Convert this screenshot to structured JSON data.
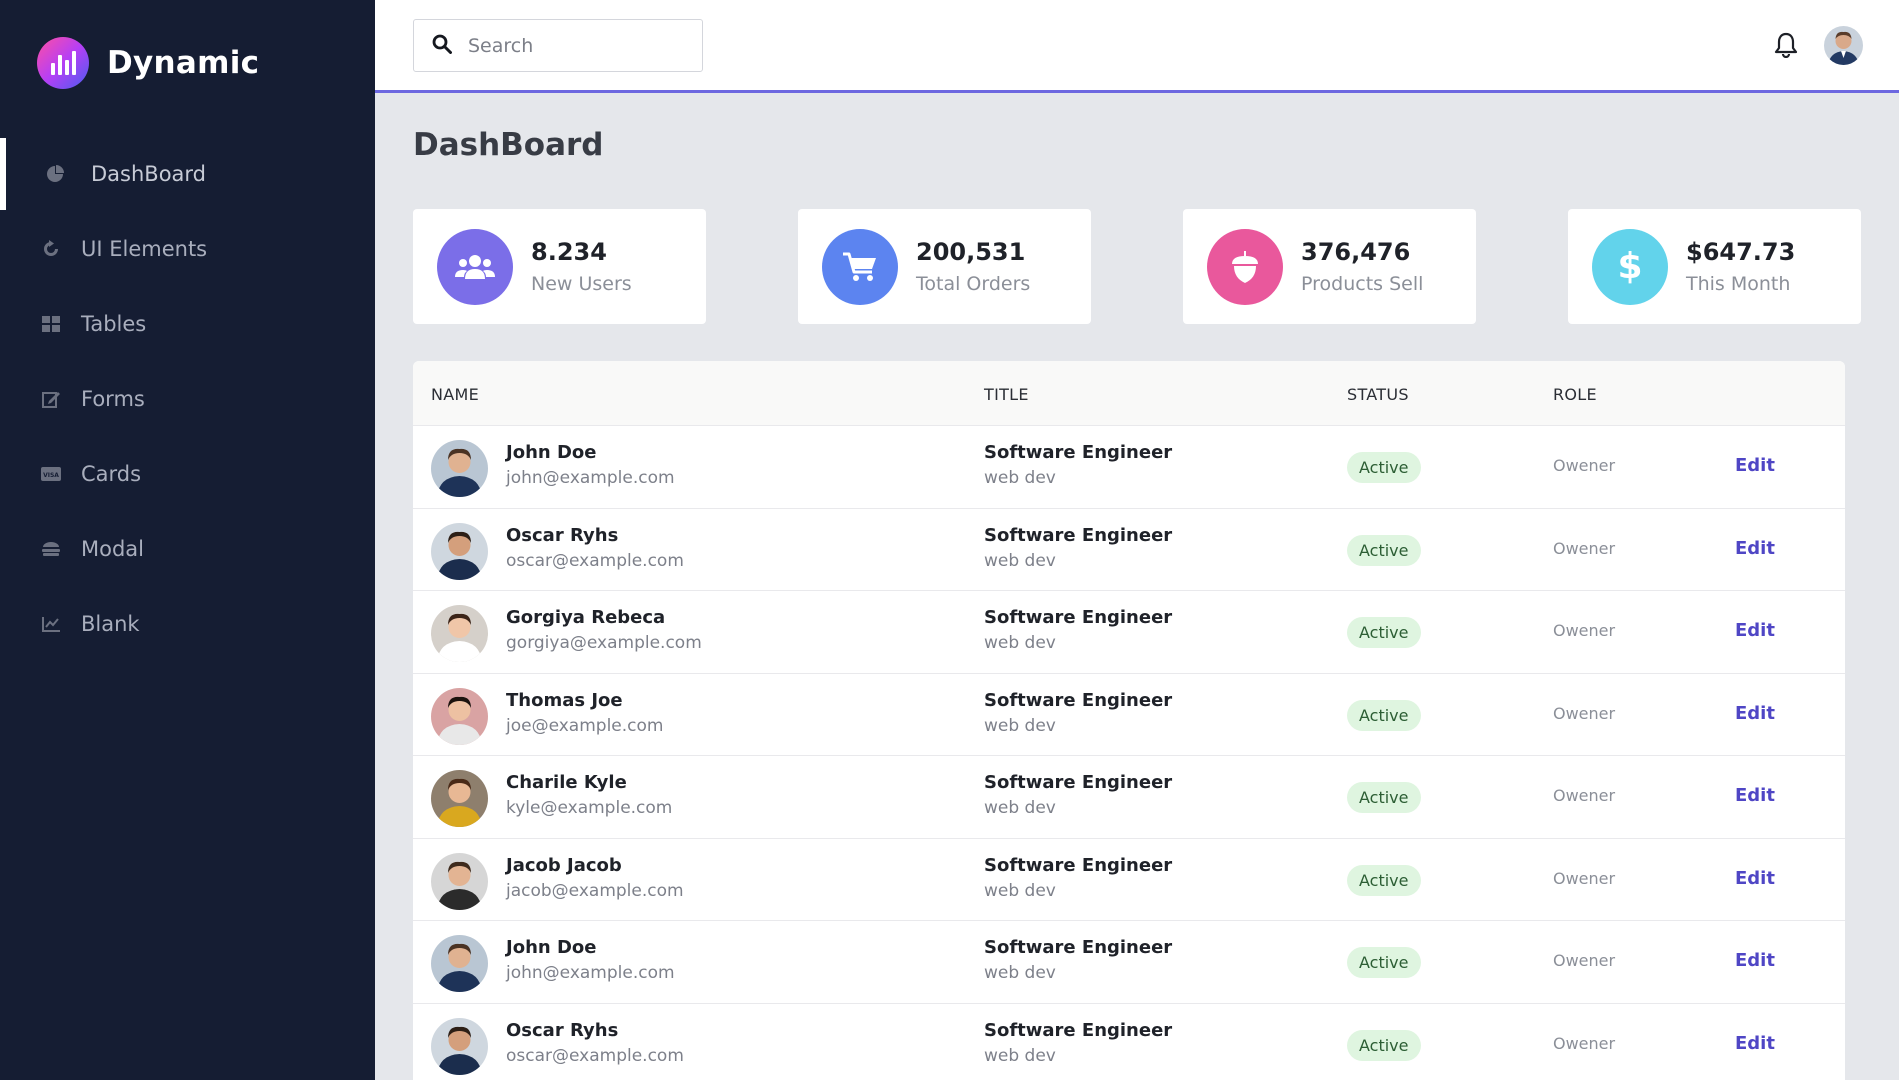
{
  "brand": {
    "name": "Dynamic"
  },
  "sidebar": {
    "items": [
      {
        "label": "DashBoard",
        "icon": "pie-chart-icon",
        "active": true
      },
      {
        "label": "UI Elements",
        "icon": "refresh-icon"
      },
      {
        "label": "Tables",
        "icon": "grid-icon"
      },
      {
        "label": "Forms",
        "icon": "edit-icon"
      },
      {
        "label": "Cards",
        "icon": "credit-card-icon"
      },
      {
        "label": "Modal",
        "icon": "layers-icon"
      },
      {
        "label": "Blank",
        "icon": "line-chart-icon"
      }
    ]
  },
  "header": {
    "search_placeholder": "Search"
  },
  "main": {
    "title": "DashBoard",
    "stats": [
      {
        "value": "8.234",
        "label": "New Users",
        "icon": "users-icon",
        "color": "#7b6ee8"
      },
      {
        "value": "200,531",
        "label": "Total Orders",
        "icon": "cart-icon",
        "color": "#5c84f0"
      },
      {
        "value": "376,476",
        "label": "Products Sell",
        "icon": "acorn-icon",
        "color": "#e9589c"
      },
      {
        "value": "$647.73",
        "label": "This Month",
        "icon": "dollar-icon",
        "color": "#62d3eb"
      }
    ],
    "table": {
      "headers": {
        "name": "NAME",
        "title": "TITLE",
        "status": "STATUS",
        "role": "ROLE"
      },
      "rows": [
        {
          "name": "John Doe",
          "email": "john@example.com",
          "title": "Software Engineer",
          "subtitle": "web dev",
          "status": "Active",
          "role": "Owener",
          "action": "Edit"
        },
        {
          "name": "Oscar Ryhs",
          "email": "oscar@example.com",
          "title": "Software Engineer",
          "subtitle": "web dev",
          "status": "Active",
          "role": "Owener",
          "action": "Edit"
        },
        {
          "name": "Gorgiya Rebeca",
          "email": "gorgiya@example.com",
          "title": "Software Engineer",
          "subtitle": "web dev",
          "status": "Active",
          "role": "Owener",
          "action": "Edit"
        },
        {
          "name": "Thomas Joe",
          "email": "joe@example.com",
          "title": "Software Engineer",
          "subtitle": "web dev",
          "status": "Active",
          "role": "Owener",
          "action": "Edit"
        },
        {
          "name": "Charile Kyle",
          "email": "kyle@example.com",
          "title": "Software Engineer",
          "subtitle": "web dev",
          "status": "Active",
          "role": "Owener",
          "action": "Edit"
        },
        {
          "name": "Jacob Jacob",
          "email": "jacob@example.com",
          "title": "Software Engineer",
          "subtitle": "web dev",
          "status": "Active",
          "role": "Owener",
          "action": "Edit"
        },
        {
          "name": "John Doe",
          "email": "john@example.com",
          "title": "Software Engineer",
          "subtitle": "web dev",
          "status": "Active",
          "role": "Owener",
          "action": "Edit"
        },
        {
          "name": "Oscar Ryhs",
          "email": "oscar@example.com",
          "title": "Software Engineer",
          "subtitle": "web dev",
          "status": "Active",
          "role": "Owener",
          "action": "Edit"
        }
      ]
    }
  }
}
